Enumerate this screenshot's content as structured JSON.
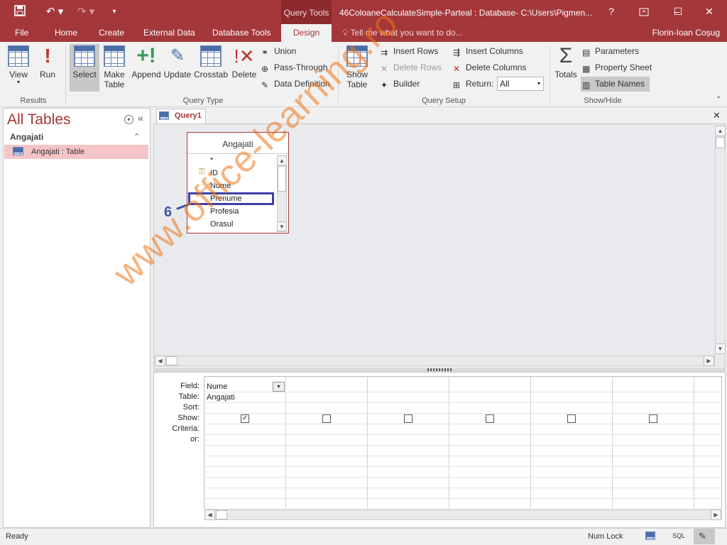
{
  "window": {
    "context_label": "Query Tools",
    "title": "46ColoaneCalculateSimple-Parteal : Database- C:\\Users\\Pigmen...",
    "help": "?",
    "minimize": "–",
    "maximize": "☐",
    "close": "✕"
  },
  "tabs": [
    "File",
    "Home",
    "Create",
    "External Data",
    "Database Tools",
    "Design"
  ],
  "tellme": "Tell me what you want to do...",
  "user": "Florin-Ioan Coșug",
  "ribbon": {
    "results": {
      "label": "Results",
      "view": "View",
      "run": "Run"
    },
    "query_type": {
      "label": "Query Type",
      "select": "Select",
      "make_table_1": "Make",
      "make_table_2": "Table",
      "append": "Append",
      "update": "Update",
      "crosstab": "Crosstab",
      "delete": "Delete",
      "union": "Union",
      "pass_through": "Pass-Through",
      "data_definition": "Data Definition"
    },
    "query_setup": {
      "label": "Query Setup",
      "show_table_1": "Show",
      "show_table_2": "Table",
      "insert_rows": "Insert Rows",
      "delete_rows": "Delete Rows",
      "builder": "Builder",
      "insert_columns": "Insert Columns",
      "delete_columns": "Delete Columns",
      "return_label": "Return:",
      "return_value": "All"
    },
    "show_hide": {
      "label": "Show/Hide",
      "totals": "Totals",
      "parameters": "Parameters",
      "property_sheet": "Property Sheet",
      "table_names": "Table Names"
    }
  },
  "nav": {
    "title": "All Tables",
    "section": "Angajati",
    "item": "Angajati : Table"
  },
  "document": {
    "tab": "Query1",
    "table": {
      "name": "Angajati",
      "fields": [
        "*",
        "ID",
        "Nume",
        "Prenume",
        "Profesia",
        "Orasul"
      ]
    },
    "annotation": "6"
  },
  "qbe": {
    "row_labels": [
      "Field:",
      "Table:",
      "Sort:",
      "Show:",
      "Criteria:",
      "or:"
    ],
    "col1_field": "Nume",
    "col1_table": "Angajati"
  },
  "status": {
    "ready": "Ready",
    "numlock": "Num Lock",
    "sql": "SQL"
  },
  "watermark": "www.office-learning.ro",
  "colors": {
    "accent": "#a4373a",
    "highlight": "#3d3fa8",
    "watermark": "#ee7418"
  }
}
